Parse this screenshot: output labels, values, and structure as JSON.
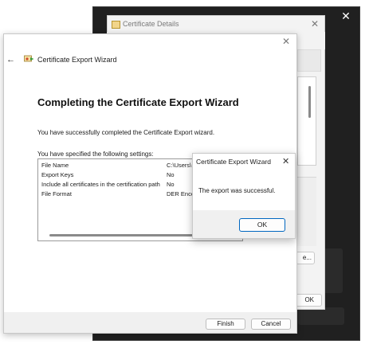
{
  "cert_window": {
    "title": "Certificate Details",
    "button_partial_1": "e...",
    "button_partial_2": "OK"
  },
  "wizard": {
    "title": "Certificate Export Wizard",
    "heading": "Completing the Certificate Export Wizard",
    "completed_text": "You have successfully completed the Certificate Export wizard.",
    "specified_text": "You have specified the following settings:",
    "settings": [
      {
        "name": "File Name",
        "value": "C:\\Users\\"
      },
      {
        "name": "Export Keys",
        "value": "No"
      },
      {
        "name": "Include all certificates in the certification path",
        "value": "No"
      },
      {
        "name": "File Format",
        "value": "DER Enco"
      }
    ],
    "finish_label": "Finish",
    "cancel_label": "Cancel"
  },
  "message_box": {
    "title": "Certificate Export Wizard",
    "text": "The export was successful.",
    "ok_label": "OK"
  },
  "icons": {
    "close": "✕",
    "back": "←"
  },
  "colors": {
    "accent": "#0067c0",
    "dark_window": "#202020"
  }
}
